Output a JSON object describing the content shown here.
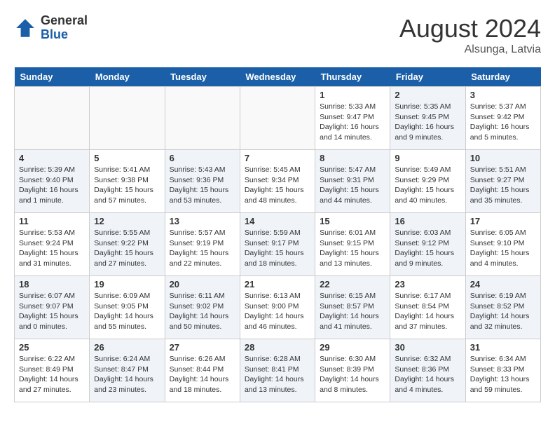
{
  "header": {
    "logo_general": "General",
    "logo_blue": "Blue",
    "month_year": "August 2024",
    "location": "Alsunga, Latvia"
  },
  "days_of_week": [
    "Sunday",
    "Monday",
    "Tuesday",
    "Wednesday",
    "Thursday",
    "Friday",
    "Saturday"
  ],
  "weeks": [
    [
      {
        "day": "",
        "info": "",
        "empty": true
      },
      {
        "day": "",
        "info": "",
        "empty": true
      },
      {
        "day": "",
        "info": "",
        "empty": true
      },
      {
        "day": "",
        "info": "",
        "empty": true
      },
      {
        "day": "1",
        "info": "Sunrise: 5:33 AM\nSunset: 9:47 PM\nDaylight: 16 hours\nand 14 minutes.",
        "empty": false
      },
      {
        "day": "2",
        "info": "Sunrise: 5:35 AM\nSunset: 9:45 PM\nDaylight: 16 hours\nand 9 minutes.",
        "empty": false
      },
      {
        "day": "3",
        "info": "Sunrise: 5:37 AM\nSunset: 9:42 PM\nDaylight: 16 hours\nand 5 minutes.",
        "empty": false
      }
    ],
    [
      {
        "day": "4",
        "info": "Sunrise: 5:39 AM\nSunset: 9:40 PM\nDaylight: 16 hours\nand 1 minute.",
        "empty": false
      },
      {
        "day": "5",
        "info": "Sunrise: 5:41 AM\nSunset: 9:38 PM\nDaylight: 15 hours\nand 57 minutes.",
        "empty": false
      },
      {
        "day": "6",
        "info": "Sunrise: 5:43 AM\nSunset: 9:36 PM\nDaylight: 15 hours\nand 53 minutes.",
        "empty": false
      },
      {
        "day": "7",
        "info": "Sunrise: 5:45 AM\nSunset: 9:34 PM\nDaylight: 15 hours\nand 48 minutes.",
        "empty": false
      },
      {
        "day": "8",
        "info": "Sunrise: 5:47 AM\nSunset: 9:31 PM\nDaylight: 15 hours\nand 44 minutes.",
        "empty": false
      },
      {
        "day": "9",
        "info": "Sunrise: 5:49 AM\nSunset: 9:29 PM\nDaylight: 15 hours\nand 40 minutes.",
        "empty": false
      },
      {
        "day": "10",
        "info": "Sunrise: 5:51 AM\nSunset: 9:27 PM\nDaylight: 15 hours\nand 35 minutes.",
        "empty": false
      }
    ],
    [
      {
        "day": "11",
        "info": "Sunrise: 5:53 AM\nSunset: 9:24 PM\nDaylight: 15 hours\nand 31 minutes.",
        "empty": false
      },
      {
        "day": "12",
        "info": "Sunrise: 5:55 AM\nSunset: 9:22 PM\nDaylight: 15 hours\nand 27 minutes.",
        "empty": false
      },
      {
        "day": "13",
        "info": "Sunrise: 5:57 AM\nSunset: 9:19 PM\nDaylight: 15 hours\nand 22 minutes.",
        "empty": false
      },
      {
        "day": "14",
        "info": "Sunrise: 5:59 AM\nSunset: 9:17 PM\nDaylight: 15 hours\nand 18 minutes.",
        "empty": false
      },
      {
        "day": "15",
        "info": "Sunrise: 6:01 AM\nSunset: 9:15 PM\nDaylight: 15 hours\nand 13 minutes.",
        "empty": false
      },
      {
        "day": "16",
        "info": "Sunrise: 6:03 AM\nSunset: 9:12 PM\nDaylight: 15 hours\nand 9 minutes.",
        "empty": false
      },
      {
        "day": "17",
        "info": "Sunrise: 6:05 AM\nSunset: 9:10 PM\nDaylight: 15 hours\nand 4 minutes.",
        "empty": false
      }
    ],
    [
      {
        "day": "18",
        "info": "Sunrise: 6:07 AM\nSunset: 9:07 PM\nDaylight: 15 hours\nand 0 minutes.",
        "empty": false
      },
      {
        "day": "19",
        "info": "Sunrise: 6:09 AM\nSunset: 9:05 PM\nDaylight: 14 hours\nand 55 minutes.",
        "empty": false
      },
      {
        "day": "20",
        "info": "Sunrise: 6:11 AM\nSunset: 9:02 PM\nDaylight: 14 hours\nand 50 minutes.",
        "empty": false
      },
      {
        "day": "21",
        "info": "Sunrise: 6:13 AM\nSunset: 9:00 PM\nDaylight: 14 hours\nand 46 minutes.",
        "empty": false
      },
      {
        "day": "22",
        "info": "Sunrise: 6:15 AM\nSunset: 8:57 PM\nDaylight: 14 hours\nand 41 minutes.",
        "empty": false
      },
      {
        "day": "23",
        "info": "Sunrise: 6:17 AM\nSunset: 8:54 PM\nDaylight: 14 hours\nand 37 minutes.",
        "empty": false
      },
      {
        "day": "24",
        "info": "Sunrise: 6:19 AM\nSunset: 8:52 PM\nDaylight: 14 hours\nand 32 minutes.",
        "empty": false
      }
    ],
    [
      {
        "day": "25",
        "info": "Sunrise: 6:22 AM\nSunset: 8:49 PM\nDaylight: 14 hours\nand 27 minutes.",
        "empty": false
      },
      {
        "day": "26",
        "info": "Sunrise: 6:24 AM\nSunset: 8:47 PM\nDaylight: 14 hours\nand 23 minutes.",
        "empty": false
      },
      {
        "day": "27",
        "info": "Sunrise: 6:26 AM\nSunset: 8:44 PM\nDaylight: 14 hours\nand 18 minutes.",
        "empty": false
      },
      {
        "day": "28",
        "info": "Sunrise: 6:28 AM\nSunset: 8:41 PM\nDaylight: 14 hours\nand 13 minutes.",
        "empty": false
      },
      {
        "day": "29",
        "info": "Sunrise: 6:30 AM\nSunset: 8:39 PM\nDaylight: 14 hours\nand 8 minutes.",
        "empty": false
      },
      {
        "day": "30",
        "info": "Sunrise: 6:32 AM\nSunset: 8:36 PM\nDaylight: 14 hours\nand 4 minutes.",
        "empty": false
      },
      {
        "day": "31",
        "info": "Sunrise: 6:34 AM\nSunset: 8:33 PM\nDaylight: 13 hours\nand 59 minutes.",
        "empty": false
      }
    ]
  ]
}
